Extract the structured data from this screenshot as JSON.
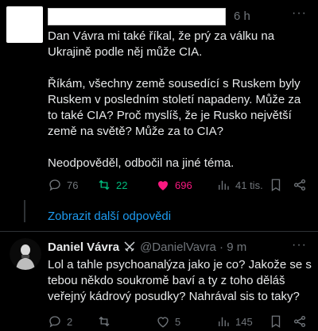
{
  "post": {
    "time": "6 h",
    "more": "···",
    "paragraphs": [
      "Dan Vávra mi také říkal, že prý za válku na Ukrajině podle něj může CIA.",
      "Říkám, všechny země sousedící s Ruskem byly Ruskem v posledním století napadeny. Může za to také CIA? Proč myslíš, že je Rusko největší země na světě? Může za to CIA?",
      "Neodpověděl, odbočil na jiné téma."
    ],
    "actions": {
      "replies": "76",
      "reposts": "22",
      "likes": "696",
      "views": "41 tis."
    }
  },
  "show_more": "Zobrazit další odpovědi",
  "reply": {
    "name": "Daniel Vávra",
    "handle": "@DanielVavra · 9 m",
    "more": "···",
    "text": "Lol a tahle psychoanalýza jako je co? Jakože se s tebou někdo soukromě baví a ty z toho děláš veřejný kádrový posudky? Nahrával sis to taky?",
    "actions": {
      "replies": "2",
      "reposts": "",
      "likes": "5",
      "views": "145"
    }
  },
  "colors": {
    "accent": "#1d9bf0",
    "repost": "#00ba7c",
    "like": "#f91880",
    "muted": "#71767b"
  }
}
